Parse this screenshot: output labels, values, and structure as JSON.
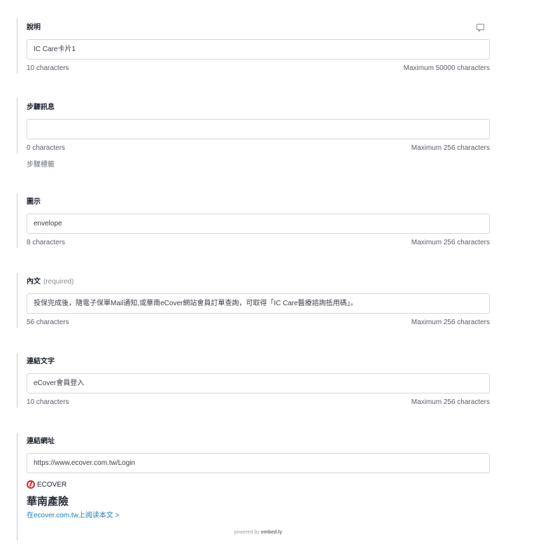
{
  "fields": {
    "description": {
      "label": "說明",
      "value": "IC Care卡片1",
      "count": "10 characters",
      "max": "Maximum 50000 characters"
    },
    "step": {
      "label": "步驟訊息",
      "value": "",
      "count": "0 characters",
      "max": "Maximum 256 characters",
      "help": "步驟標籤"
    },
    "icon": {
      "label": "圖示",
      "value": "envelope",
      "count": "8 characters",
      "max": "Maximum 256 characters"
    },
    "body": {
      "label": "內文",
      "required": "(required)",
      "value": "投保完成後，隨電子保單Mail通知,或華南eCover網站會員訂單查詢，可取得「IC Care醫療諮詢抵用碼」。",
      "count": "56 characters",
      "max": "Maximum 256 characters"
    },
    "link_text": {
      "label": "連結文字",
      "value": "eCover會員登入",
      "count": "10 characters",
      "max": "Maximum 256 characters"
    },
    "link_url": {
      "label": "連結網址",
      "value": "https://www.ecover.com.tw/Login"
    }
  },
  "embed": {
    "provider": "ECOVER",
    "title": "華南產險",
    "link": "在ecover.com.tw上阅读本文 >",
    "powered_prefix": "powered by",
    "powered_brand": "embed.ly"
  },
  "icons": {
    "comment": "comment-icon",
    "provider_logo": "ecover-logo-icon"
  },
  "colors": {
    "accent_link": "#1a7fb6",
    "brand_red": "#d7262c"
  }
}
